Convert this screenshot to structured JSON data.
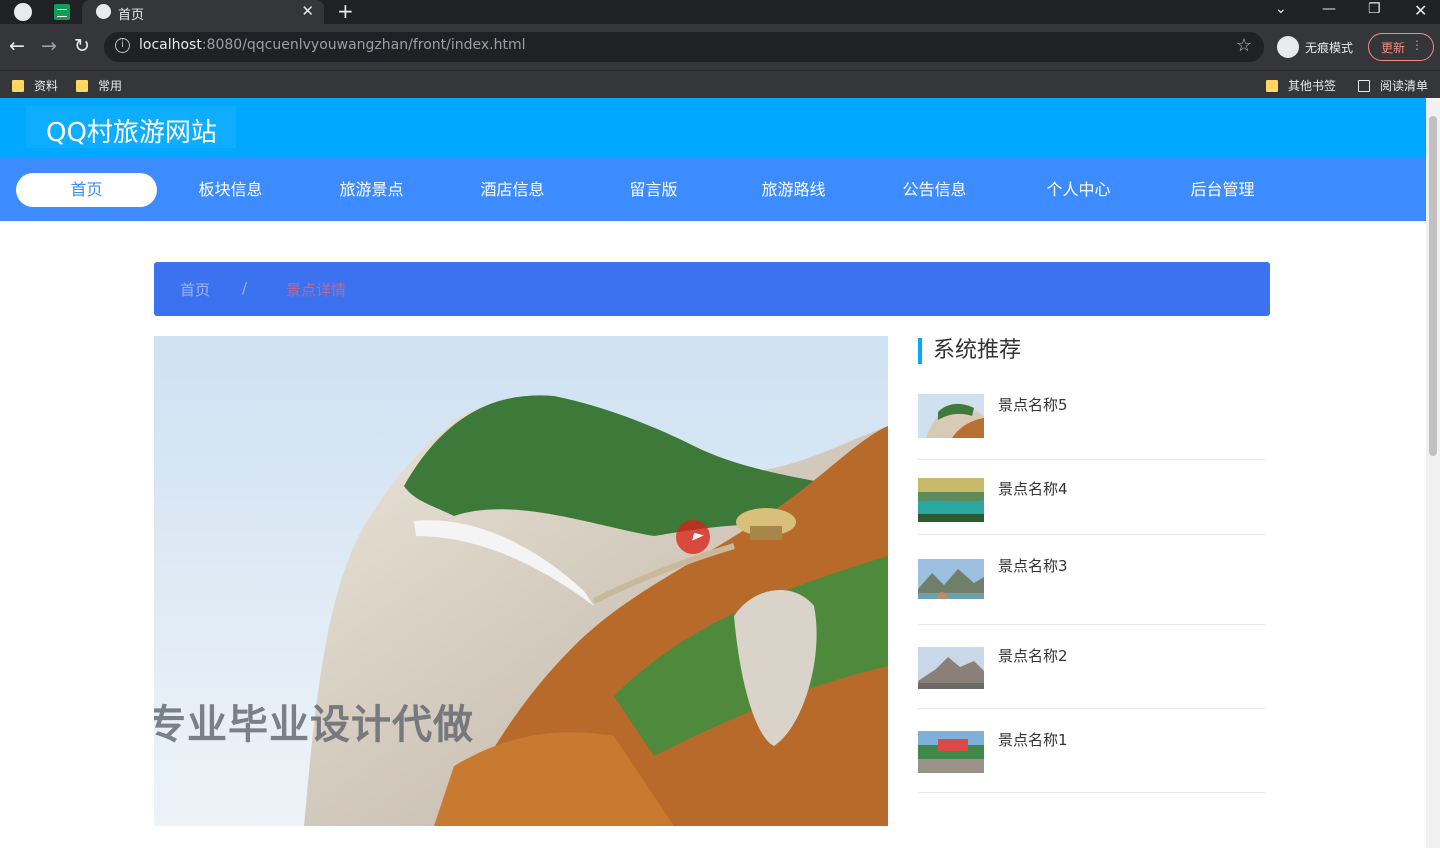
{
  "browser": {
    "tab_title": "首页",
    "url_host": "localhost",
    "url_rest": ":8080/qqcuenlvyouwangzhan/front/index.html",
    "incognito_label": "无痕模式",
    "update_label": "更新",
    "bookmarks": [
      "资料",
      "常用"
    ],
    "other_bookmarks": "其他书签",
    "reading_list": "阅读清单"
  },
  "site": {
    "title": "QQ村旅游网站",
    "nav": [
      "首页",
      "板块信息",
      "旅游景点",
      "酒店信息",
      "留言版",
      "旅游路线",
      "公告信息",
      "个人中心",
      "后台管理"
    ],
    "breadcrumb": {
      "home": "首页",
      "sep": "/",
      "current": "景点详情"
    },
    "hero_watermark": "专业毕业设计代做",
    "recommend": {
      "title": "系统推荐",
      "items": [
        "景点名称5",
        "景点名称4",
        "景点名称3",
        "景点名称2",
        "景点名称1"
      ]
    }
  },
  "colors": {
    "header": "#00a8ff",
    "menu": "#3c8cff",
    "breadcrumb": "#3c72f0",
    "accent": "#00a8ff"
  }
}
